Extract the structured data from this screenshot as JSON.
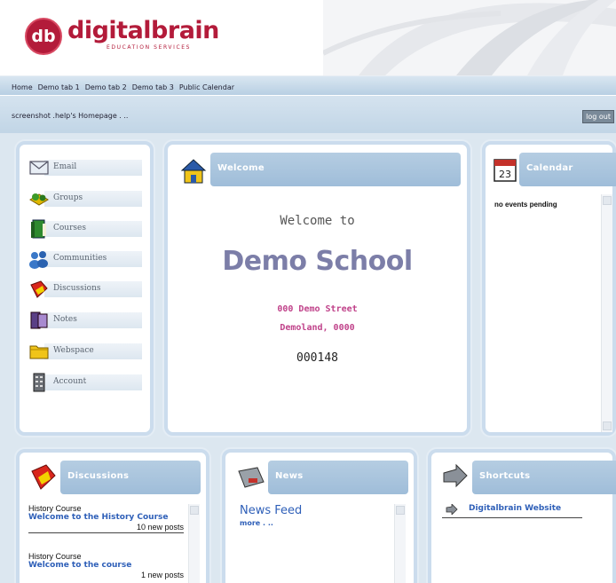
{
  "logo": {
    "mark": "db",
    "name": "digitalbrain",
    "tagline": "EDUCATION SERVICES"
  },
  "nav": [
    "Home",
    "Demo tab 1",
    "Demo tab 2",
    "Demo tab 3",
    "Public Calendar"
  ],
  "breadcrumb": "screenshot .help's Homepage . ..",
  "logout_label": "log out",
  "menu": [
    {
      "label": "Email",
      "icon": "envelope-icon"
    },
    {
      "label": "Groups",
      "icon": "groups-icon"
    },
    {
      "label": "Courses",
      "icon": "book-icon"
    },
    {
      "label": "Communities",
      "icon": "people-icon"
    },
    {
      "label": "Discussions",
      "icon": "discussions-icon"
    },
    {
      "label": "Notes",
      "icon": "notes-icon"
    },
    {
      "label": "Webspace",
      "icon": "folder-icon"
    },
    {
      "label": "Account",
      "icon": "building-icon"
    }
  ],
  "welcome": {
    "title": "Welcome",
    "welcome_to": "Welcome to",
    "school": "Demo School",
    "address1": "000 Demo Street",
    "address2": "Demoland, 0000",
    "code": "000148"
  },
  "calendar": {
    "title": "Calendar",
    "status": "no events pending"
  },
  "discussions": {
    "title": "Discussions",
    "items": [
      {
        "course": "History Course",
        "topic": "Welcome to the History Course",
        "posts": "10 new posts"
      },
      {
        "course": "History Course",
        "topic": "Welcome to the course",
        "posts": "1 new posts"
      }
    ]
  },
  "news": {
    "title": "News",
    "feed": "News Feed",
    "more": "more . .."
  },
  "shortcuts": {
    "title": "Shortcuts",
    "items": [
      "Digitalbrain Website"
    ]
  },
  "colors": {
    "brand": "#b31b3a",
    "panel_title": "#a6c2dc",
    "school_text": "#7c7ea8",
    "address_text": "#c0428a",
    "link": "#2e5fb8"
  }
}
